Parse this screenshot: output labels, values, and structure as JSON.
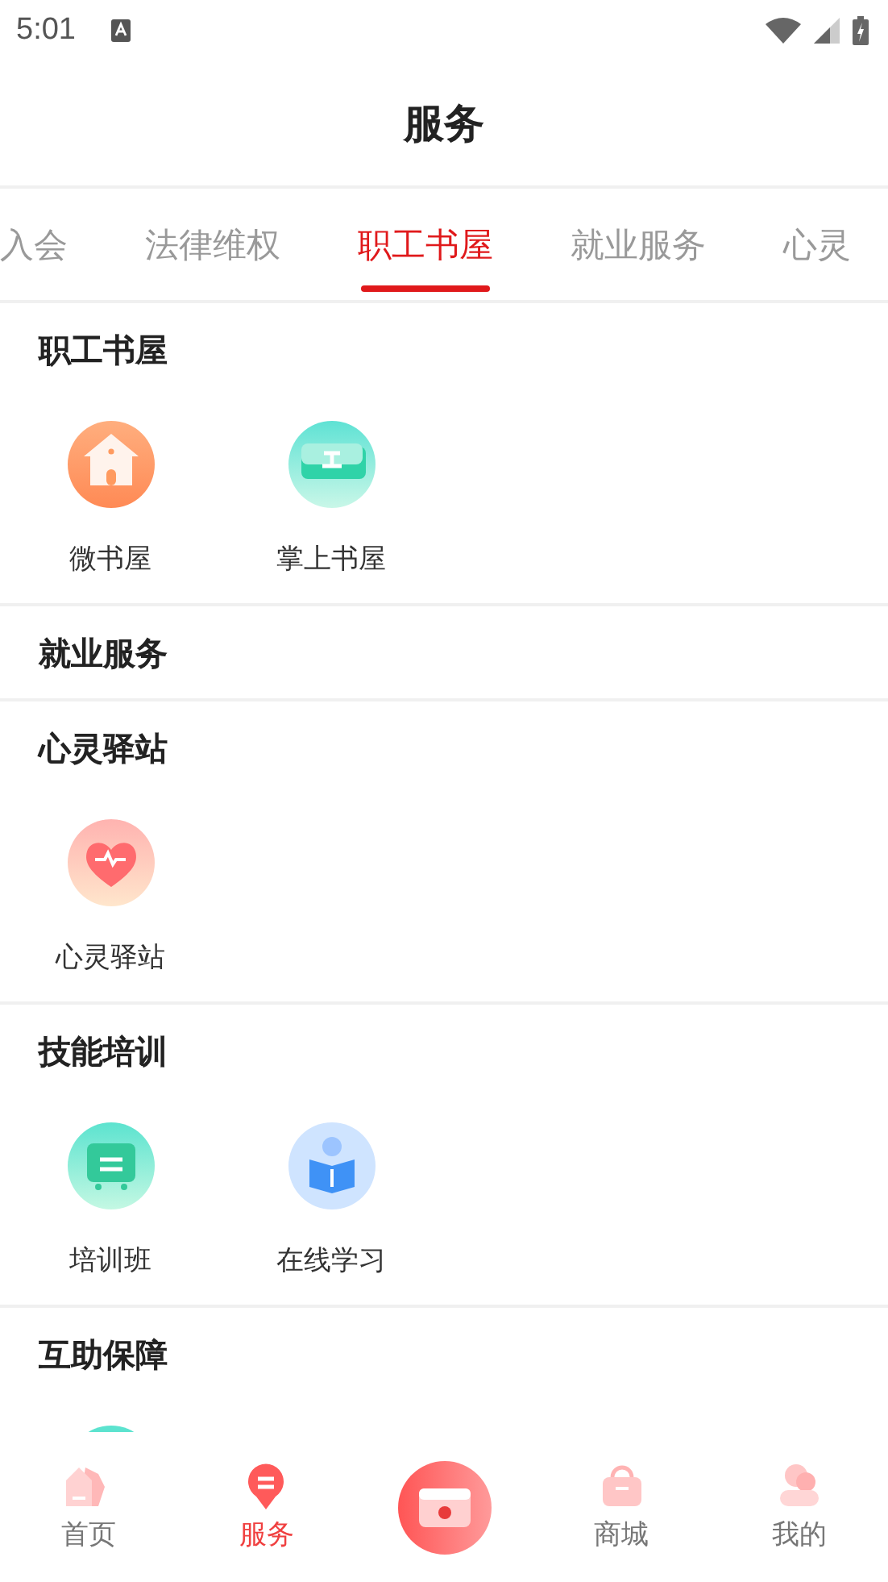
{
  "status_bar": {
    "time": "5:01"
  },
  "header": {
    "title": "服务"
  },
  "tabs": [
    {
      "label": "入会",
      "selected": false
    },
    {
      "label": "法律维权",
      "selected": false
    },
    {
      "label": "职工书屋",
      "selected": true
    },
    {
      "label": "就业服务",
      "selected": false
    },
    {
      "label": "心灵",
      "selected": false
    }
  ],
  "sections": [
    {
      "title": "职工书屋",
      "items": [
        {
          "label": "微书屋",
          "kind": "house"
        },
        {
          "label": "掌上书屋",
          "kind": "book"
        }
      ]
    },
    {
      "title": "就业服务"
    },
    {
      "title": "心灵驿站",
      "items": [
        {
          "label": "心灵驿站",
          "kind": "heart"
        }
      ]
    },
    {
      "title": "技能培训",
      "items": [
        {
          "label": "培训班",
          "kind": "board"
        },
        {
          "label": "在线学习",
          "kind": "reader"
        }
      ]
    },
    {
      "title": "互助保障",
      "items": [
        {
          "kind": "partial"
        }
      ]
    }
  ],
  "bottom_nav": [
    {
      "label": "首页",
      "kind": "home",
      "selected": false
    },
    {
      "label": "服务",
      "kind": "service",
      "selected": true
    },
    {
      "kind": "card"
    },
    {
      "label": "商城",
      "kind": "bag",
      "selected": false
    },
    {
      "label": "我的",
      "kind": "user",
      "selected": false
    }
  ]
}
